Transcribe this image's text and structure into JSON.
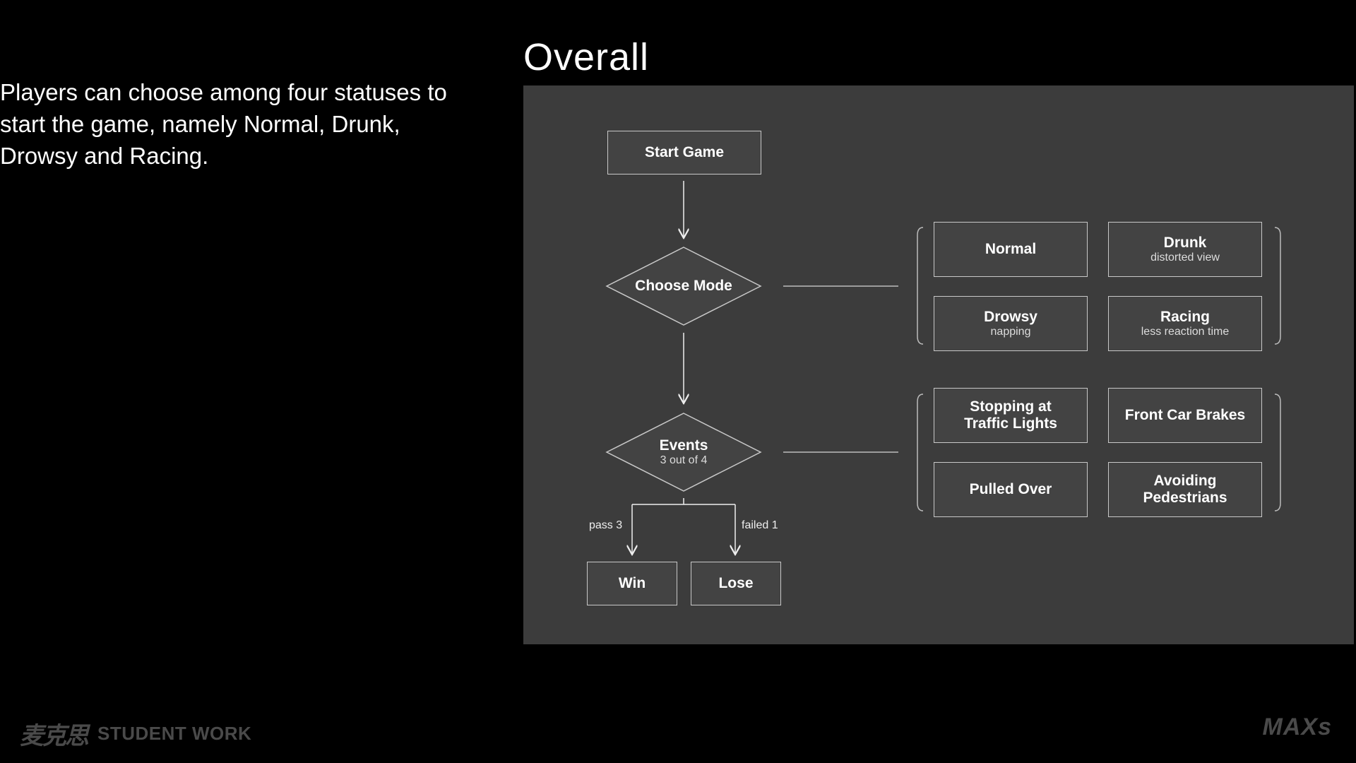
{
  "slide": {
    "title": "Overall",
    "description": "Players can choose among four statuses to start the game, namely Normal, Drunk, Drowsy and Racing."
  },
  "flow": {
    "start": "Start Game",
    "choose_mode": "Choose Mode",
    "events": {
      "label": "Events",
      "sub": "3 out of 4"
    },
    "pass_label": "pass 3",
    "failed_label": "failed 1",
    "win": "Win",
    "lose": "Lose"
  },
  "modes": [
    {
      "label": "Normal",
      "sub": ""
    },
    {
      "label": "Drunk",
      "sub": "distorted view"
    },
    {
      "label": "Drowsy",
      "sub": "napping"
    },
    {
      "label": "Racing",
      "sub": "less reaction time"
    }
  ],
  "events_list": [
    {
      "label": "Stopping at Traffic Lights"
    },
    {
      "label": "Front Car Brakes"
    },
    {
      "label": "Pulled Over"
    },
    {
      "label": "Avoiding Pedestrians"
    }
  ],
  "footer": {
    "brand_cn": "麦克思",
    "student_work": "STUDENT WORK",
    "brand_right": "MAXs"
  }
}
